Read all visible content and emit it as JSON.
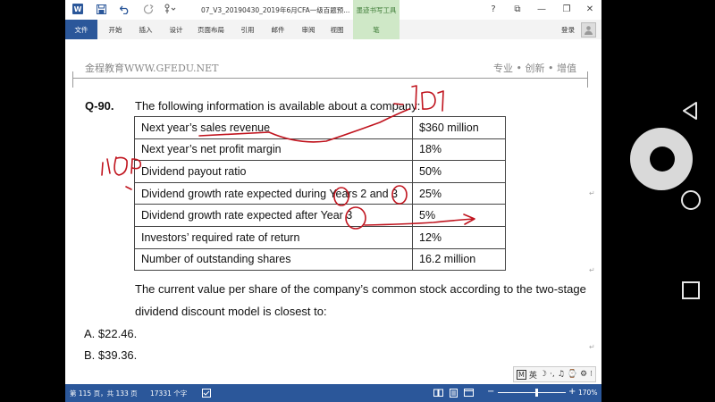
{
  "titlebar": {
    "app_icon": "W",
    "save_icon": "save-icon",
    "undo_icon": "undo-icon",
    "redo_icon": "redo-icon",
    "touch_icon": "touch-mode-icon",
    "doc_title": "07_V3_20190430_2019年6月CFA一级百题预...",
    "ink_tools": "墨迹书写工具",
    "help": "?",
    "ribbon_display": "⧉",
    "minimize": "—",
    "restore": "❐",
    "close": "✕"
  },
  "ribbon": {
    "tabs": [
      "文件",
      "开始",
      "插入",
      "设计",
      "页面布局",
      "引用",
      "邮件",
      "审阅",
      "视图",
      "笔"
    ],
    "login": "登录",
    "avatar_icon": "user-icon"
  },
  "header": {
    "left": "金程教育WWW.GFEDU.NET",
    "right": "专业 • 创新 • 增值"
  },
  "question": {
    "number": "Q-90.",
    "intro": "The following information is available about a company:",
    "table": [
      {
        "label": "Next year’s sales revenue",
        "value": "$360 million"
      },
      {
        "label": "Next year’s net profit margin",
        "value": "18%"
      },
      {
        "label": "Dividend payout ratio",
        "value": "50%"
      },
      {
        "label": "Dividend growth rate expected during Years 2 and 3",
        "value": "25%"
      },
      {
        "label": "Dividend growth rate expected after Year 3",
        "value": "5%"
      },
      {
        "label": "Investors’ required rate of return",
        "value": "12%"
      },
      {
        "label": "Number of outstanding shares",
        "value": "16.2 million"
      }
    ],
    "body_line1": "The current value per share of the company’s common stock according to the two-stage",
    "body_line2": "dividend discount model is closest to:",
    "options": [
      "A. $22.46.",
      "B. $39.36."
    ]
  },
  "ime": {
    "mode": "M",
    "lang": "英",
    "items": [
      "☽",
      "·,",
      "♫",
      "⌚",
      "⚙",
      "⁝"
    ]
  },
  "statusbar": {
    "page": "第 115 页，共 133 页",
    "words": "17331 个字",
    "proofing_icon": "proofing-icon",
    "read_mode_icon": "read-mode-icon",
    "print_layout_icon": "print-layout-icon",
    "web_layout_icon": "web-layout-icon",
    "zoom_out": "−",
    "zoom_in": "+",
    "zoom": "170%"
  },
  "android_nav": {
    "back": "back-icon",
    "home": "home-icon",
    "recent": "recent-apps-icon"
  },
  "colors": {
    "word_blue": "#2b579a",
    "ink_green": "#cfe8c7",
    "ink_red": "#c0141e"
  }
}
